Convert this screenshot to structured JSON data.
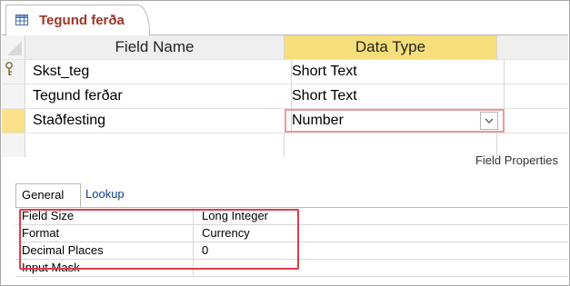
{
  "tab": {
    "title": "Tegund ferða"
  },
  "grid": {
    "headers": {
      "field_name": "Field Name",
      "data_type": "Data Type"
    },
    "rows": [
      {
        "field_name": "Skst_teg",
        "data_type": "Short Text",
        "primary_key": true
      },
      {
        "field_name": "Tegund ferðar",
        "data_type": "Short Text",
        "primary_key": false
      },
      {
        "field_name": "Staðfesting",
        "data_type": "Number",
        "primary_key": false,
        "selected": true
      }
    ]
  },
  "field_properties_label": "Field Properties",
  "property_tabs": [
    {
      "label": "General",
      "active": true
    },
    {
      "label": "Lookup",
      "active": false
    }
  ],
  "properties": [
    {
      "name": "Field Size",
      "value": "Long Integer"
    },
    {
      "name": "Format",
      "value": "Currency"
    },
    {
      "name": "Decimal Places",
      "value": "0"
    },
    {
      "name": "Input Mask",
      "value": ""
    }
  ],
  "colors": {
    "tab_title": "#a03528",
    "data_type_header": "#f6df7b",
    "current_row_selector": "#fbe08a",
    "highlight_box": "#e03a48"
  }
}
